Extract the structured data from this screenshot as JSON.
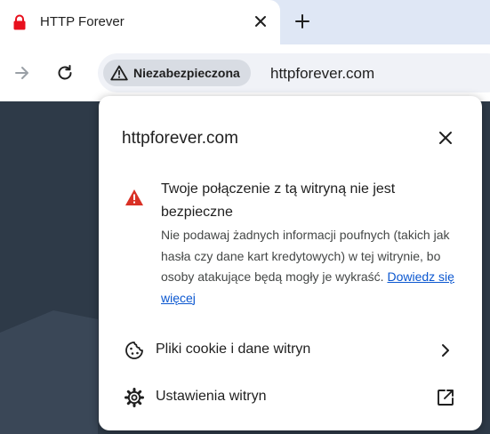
{
  "tab": {
    "title": "HTTP Forever",
    "favicon": "lock-icon",
    "close_icon": "close-icon",
    "new_tab_icon": "plus-icon"
  },
  "toolbar": {
    "forward_icon": "arrow-right-icon",
    "reload_icon": "reload-icon",
    "security_chip_label": "Niezabezpieczona",
    "security_icon": "warning-triangle-icon",
    "url": "httpforever.com"
  },
  "popup": {
    "site": "httpforever.com",
    "security_title": "Twoje połączenie z tą witryną nie jest bezpieczne",
    "security_body": "Nie podawaj żadnych informacji poufnych (takich jak hasła czy dane kart kredytowych) w tej witrynie, bo osoby atakujące będą mogły je wykraść.",
    "learn_more": "Dowiedz się więcej",
    "rows": [
      {
        "label": "Pliki cookie i dane witryn",
        "icon": "cookie-icon",
        "trailing": "chevron-right-icon"
      },
      {
        "label": "Ustawienia witryn",
        "icon": "gear-icon",
        "trailing": "open-in-new-icon"
      }
    ]
  },
  "colors": {
    "accent_link": "#0b57d0",
    "warning_red": "#d93025",
    "page_background": "#2e3a48",
    "favicon_red": "#e8101d"
  }
}
